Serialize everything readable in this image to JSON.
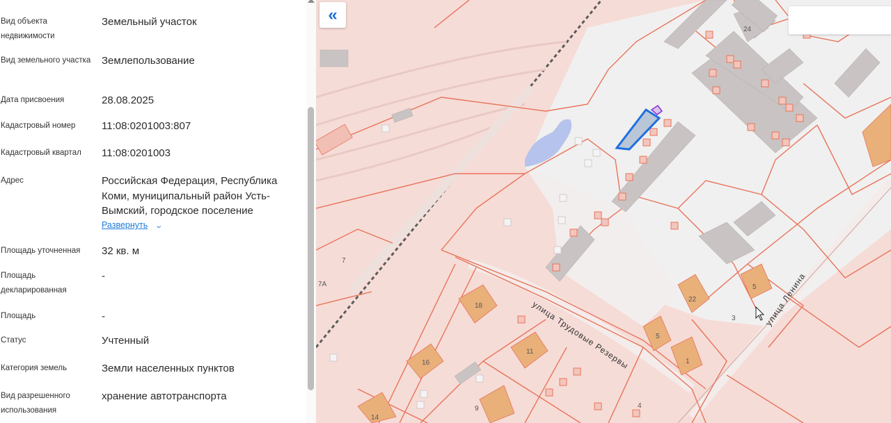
{
  "properties": [
    {
      "label": "Вид объекта недвижимости",
      "value": "Земельный участок"
    },
    {
      "label": "Вид земельного участка",
      "value": "Землепользование"
    },
    {
      "label": "Дата присвоения",
      "value": "28.08.2025"
    },
    {
      "label": "Кадастровый номер",
      "value": "11:08:0201003:807"
    },
    {
      "label": "Кадастровый квартал",
      "value": "11:08:0201003"
    },
    {
      "label": "Адрес",
      "value": "Российская Федерация, Республика Коми, муниципальный район Усть-Вымский, городское поселение"
    },
    {
      "label": "Площадь уточненная",
      "value": "32 кв. м"
    },
    {
      "label": "Площадь декларированная",
      "value": "-"
    },
    {
      "label": "Площадь",
      "value": "-"
    },
    {
      "label": "Статус",
      "value": "Учтенный"
    },
    {
      "label": "Категория земель",
      "value": "Земли населенных пунктов"
    },
    {
      "label": "Вид разрешенного использования",
      "value": "хранение автотранспорта"
    }
  ],
  "address_expand_label": "Развернуть",
  "map": {
    "collapse_icon": "double-chevron-left-icon",
    "streets": [
      "улица Трудовые Резервы",
      "улица Ленина"
    ],
    "building_numbers": [
      "24",
      "7",
      "7А",
      "18",
      "22",
      "5",
      "5",
      "3",
      "11",
      "16",
      "1",
      "9",
      "14",
      "4"
    ],
    "colors": {
      "parcel_line": "#e8735a",
      "parcel_fill": "#f6dcd7",
      "selected_parcel": "#1e6fe0",
      "building": "#e9b07a",
      "water": "#b6c3ec"
    }
  }
}
